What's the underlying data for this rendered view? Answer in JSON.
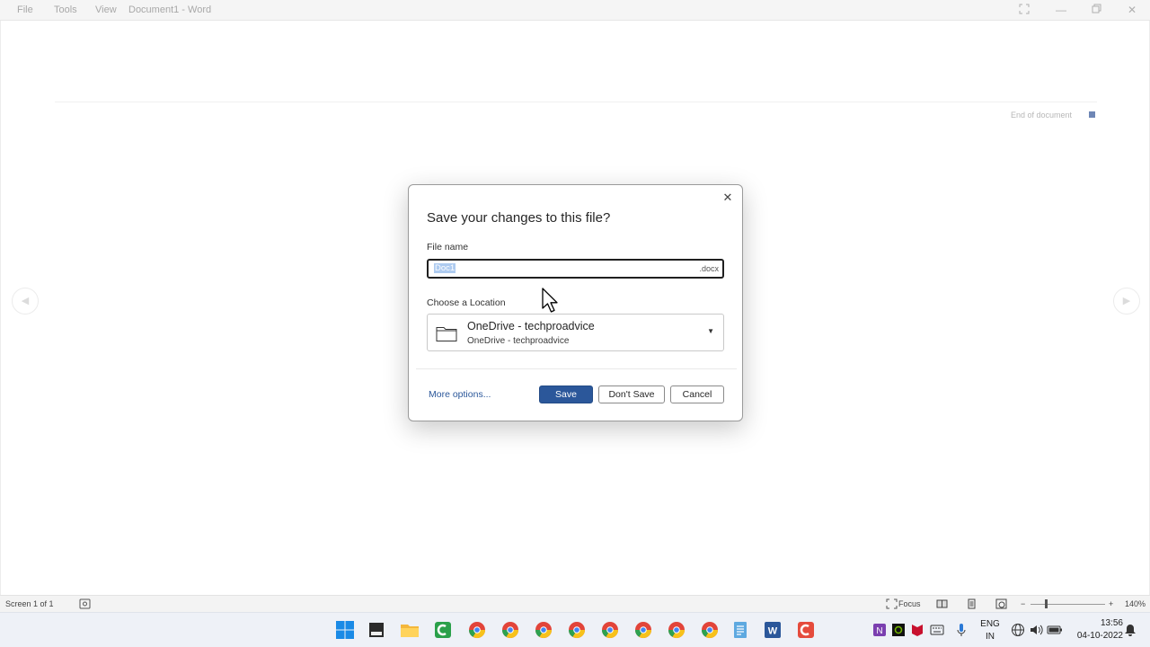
{
  "window": {
    "menu": [
      "File",
      "Tools",
      "View"
    ],
    "title": "Document1  -  Word"
  },
  "document": {
    "end_marker": "End of document"
  },
  "dialog": {
    "title": "Save your changes to this file?",
    "file_name_label": "File name",
    "file_name_value": "Doc1",
    "file_extension": ".docx",
    "location_label": "Choose a Location",
    "location_primary": "OneDrive - techproadvice",
    "location_secondary": "OneDrive - techproadvice",
    "more_options": "More options...",
    "save_label": "Save",
    "dont_save_label": "Don't Save",
    "cancel_label": "Cancel"
  },
  "statusbar": {
    "screen_info": "Screen 1 of 1",
    "focus_label": "Focus",
    "zoom": "140%"
  },
  "taskbar": {
    "language": "ENG",
    "region": "IN",
    "time": "13:56",
    "date": "04-10-2022",
    "apps": [
      "start-icon",
      "file-explorer-icon",
      "folder-icon",
      "camtasia-icon",
      "chrome-h-icon",
      "chrome-icon",
      "chrome-icon",
      "chrome-icon",
      "chrome-g-icon",
      "chrome-g-icon",
      "chrome-s-icon",
      "chrome-icon",
      "notepad-icon",
      "word-icon",
      "camtasia-red-icon"
    ]
  },
  "colors": {
    "accent": "#2b579a",
    "selection": "#aecbf0"
  }
}
